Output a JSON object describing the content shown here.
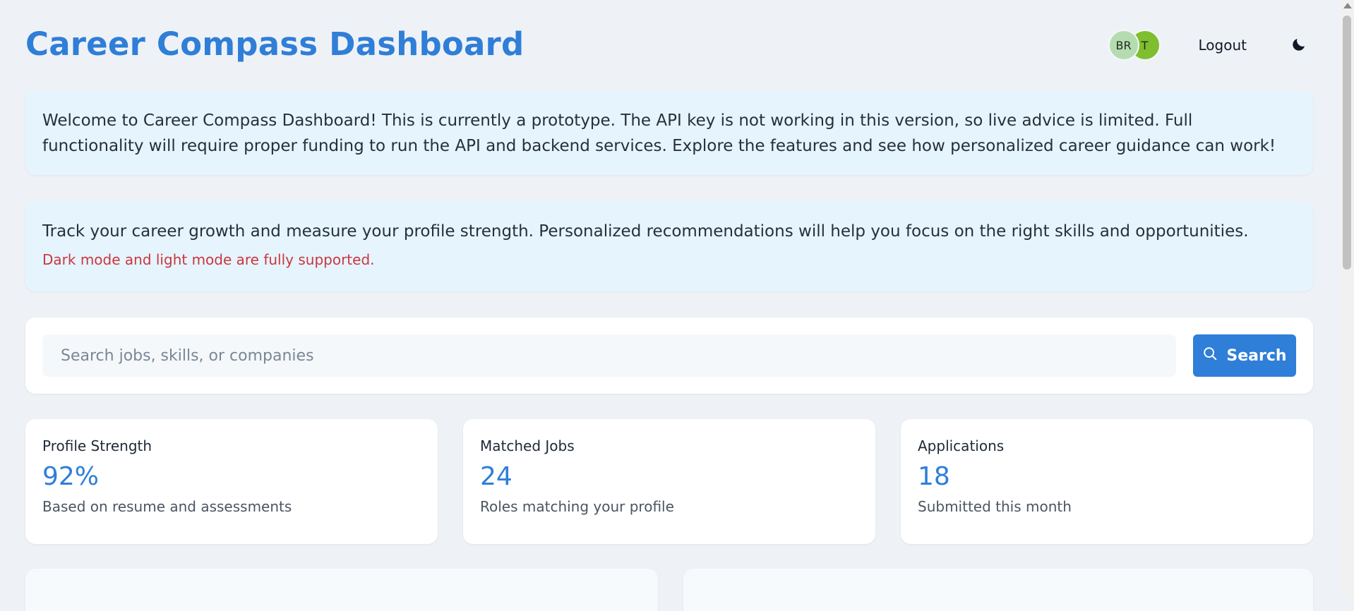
{
  "header": {
    "title": "Career Compass Dashboard",
    "avatars": [
      "BR",
      "T"
    ],
    "logout_label": "Logout",
    "theme_icon": "moon-icon"
  },
  "notice": {
    "text": "Welcome to Career Compass Dashboard! This is currently a prototype. The API key is not working in this version, so live advice is limited. Full functionality will require proper funding to run the API and backend services. Explore the features and see how personalized career guidance can work!"
  },
  "info": {
    "text": "Track your career growth and measure your profile strength. Personalized recommendations will help you focus on the right skills and opportunities.",
    "note": "Dark mode and light mode are fully supported."
  },
  "search": {
    "placeholder": "Search jobs, skills, or companies",
    "button_label": "Search",
    "button_icon": "search-icon"
  },
  "stats": [
    {
      "label": "Profile Strength",
      "value": "92%",
      "desc": "Based on resume and assessments"
    },
    {
      "label": "Matched Jobs",
      "value": "24",
      "desc": "Roles matching your profile"
    },
    {
      "label": "Applications",
      "value": "18",
      "desc": "Submitted this month"
    }
  ],
  "colors": {
    "accent": "#2f7ed8",
    "background": "#eef2f6",
    "notice_bg": "#e6f4fd",
    "note_red": "#c9373f",
    "avatar_1": "#b5dcb1",
    "avatar_2": "#7fbe2e"
  }
}
